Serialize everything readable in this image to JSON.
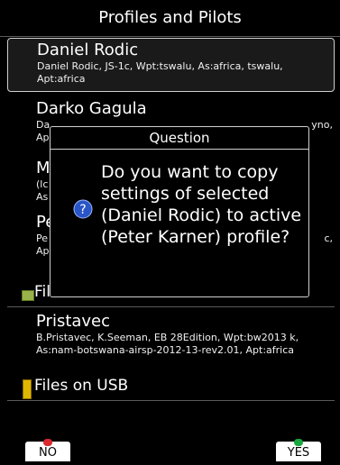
{
  "header": {
    "title": "Profiles and Pilots"
  },
  "profiles": [
    {
      "name": "Daniel Rodic",
      "details": "Daniel Rodic, JS-1c, Wpt:tswalu, As:africa, tswalu, Apt:africa",
      "selected": true
    },
    {
      "name": "Darko Gagula",
      "details": "Da",
      "details_right": "yno,",
      "details2": "Ap"
    },
    {
      "name": "M",
      "details": "(lc",
      "details2": "As"
    },
    {
      "name": "Pe",
      "details": "Pe",
      "details_right": "c,",
      "details2": "Ap"
    }
  ],
  "sections": {
    "sd": {
      "label": "Files on SD",
      "icon": "sd-card-icon"
    },
    "usb": {
      "label": "Files on USB",
      "icon": "usb-icon"
    }
  },
  "sd_files": [
    {
      "name": "Pristavec",
      "details": "B.Pristavec, K.Seeman, EB 28Edition, Wpt:bw2013 k, As:nam-botswana-airsp-2012-13-rev2.01, Apt:africa"
    }
  ],
  "dialog": {
    "title": "Question",
    "message": "Do you want to copy settings of selected (Daniel Rodic) to active (Peter Karner) profile?",
    "icon": "question-icon"
  },
  "buttons": {
    "no": "NO",
    "yes": "YES"
  }
}
